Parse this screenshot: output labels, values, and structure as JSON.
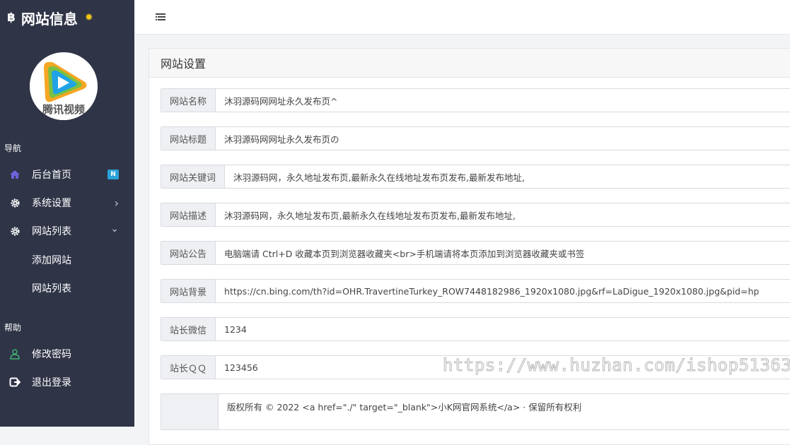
{
  "app": {
    "brand_title": "网站信息",
    "brand_symbol": "฿",
    "avatar_text": "腾讯视频"
  },
  "sidebar": {
    "nav_label": "导航",
    "help_label": "帮助",
    "items": [
      {
        "label": "后台首页",
        "icon": "home-icon",
        "badge": "N"
      },
      {
        "label": "系统设置",
        "icon": "gear-icon",
        "arrow": "›"
      },
      {
        "label": "网站列表",
        "icon": "gear-icon",
        "arrow": "⌄"
      }
    ],
    "subitems": [
      {
        "label": "添加网站"
      },
      {
        "label": "网站列表"
      }
    ],
    "help_items": [
      {
        "label": "修改密码",
        "icon": "user-icon"
      },
      {
        "label": "退出登录",
        "icon": "logout-icon"
      }
    ]
  },
  "main": {
    "card_title": "网站设置",
    "fields": [
      {
        "label": "网站名称",
        "value": "沐羽源码网网址永久发布页^"
      },
      {
        "label": "网站标题",
        "value": "沐羽源码网网址永久发布页の"
      },
      {
        "label": "网站关键词",
        "value": "沐羽源码网，永久地址发布页,最新永久在线地址发布页发布,最新发布地址,"
      },
      {
        "label": "网站描述",
        "value": "沐羽源码网，永久地址发布页,最新永久在线地址发布页发布,最新发布地址,"
      },
      {
        "label": "网站公告",
        "value": "电脑端请 Ctrl+D 收藏本页到浏览器收藏夹<br>手机端请将本页添加到浏览器收藏夹或书签"
      },
      {
        "label": "网站背景",
        "value": "https://cn.bing.com/th?id=OHR.TravertineTurkey_ROW7448182986_1920x1080.jpg&rf=LaDigue_1920x1080.jpg&pid=hp"
      },
      {
        "label": "站长微信",
        "value": "1234"
      },
      {
        "label": "站长ＱＱ",
        "value": "123456"
      },
      {
        "label": "",
        "value": "版权所有 © 2022 <a href=\"./\" target=\"_blank\">小K网官网系统</a> · 保留所有权利"
      }
    ]
  },
  "watermark": "https://www.huzhan.com/ishop51363",
  "colors": {
    "sidebar_bg": "#2f3447",
    "badge": "#2aa3d8",
    "brand_gear": "#f0c419",
    "user_icon": "#3cb371"
  }
}
